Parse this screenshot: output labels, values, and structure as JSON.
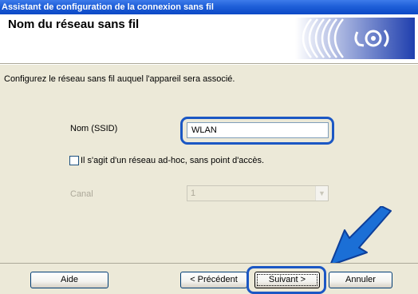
{
  "window": {
    "title": "Assistant de configuration de la connexion sans fil"
  },
  "header": {
    "title": "Nom du réseau sans fil",
    "logo_icon": "wireless-logo-icon"
  },
  "body": {
    "description": "Configurez le réseau sans fil auquel l'appareil sera associé.",
    "ssid": {
      "label": "Nom (SSID)",
      "value": "WLAN"
    },
    "adhoc": {
      "label": "Il s'agit d'un réseau ad-hoc, sans point d'accès.",
      "checked": false
    },
    "canal": {
      "label": "Canal",
      "value": "1",
      "disabled": true
    }
  },
  "footer": {
    "help_label": "Aide",
    "prev_label": "< Précédent",
    "next_label": "Suivant >",
    "cancel_label": "Annuler"
  },
  "colors": {
    "titlebar": "#0b48c6",
    "highlight": "#1b57c4",
    "dialog_bg": "#ece9d8"
  }
}
